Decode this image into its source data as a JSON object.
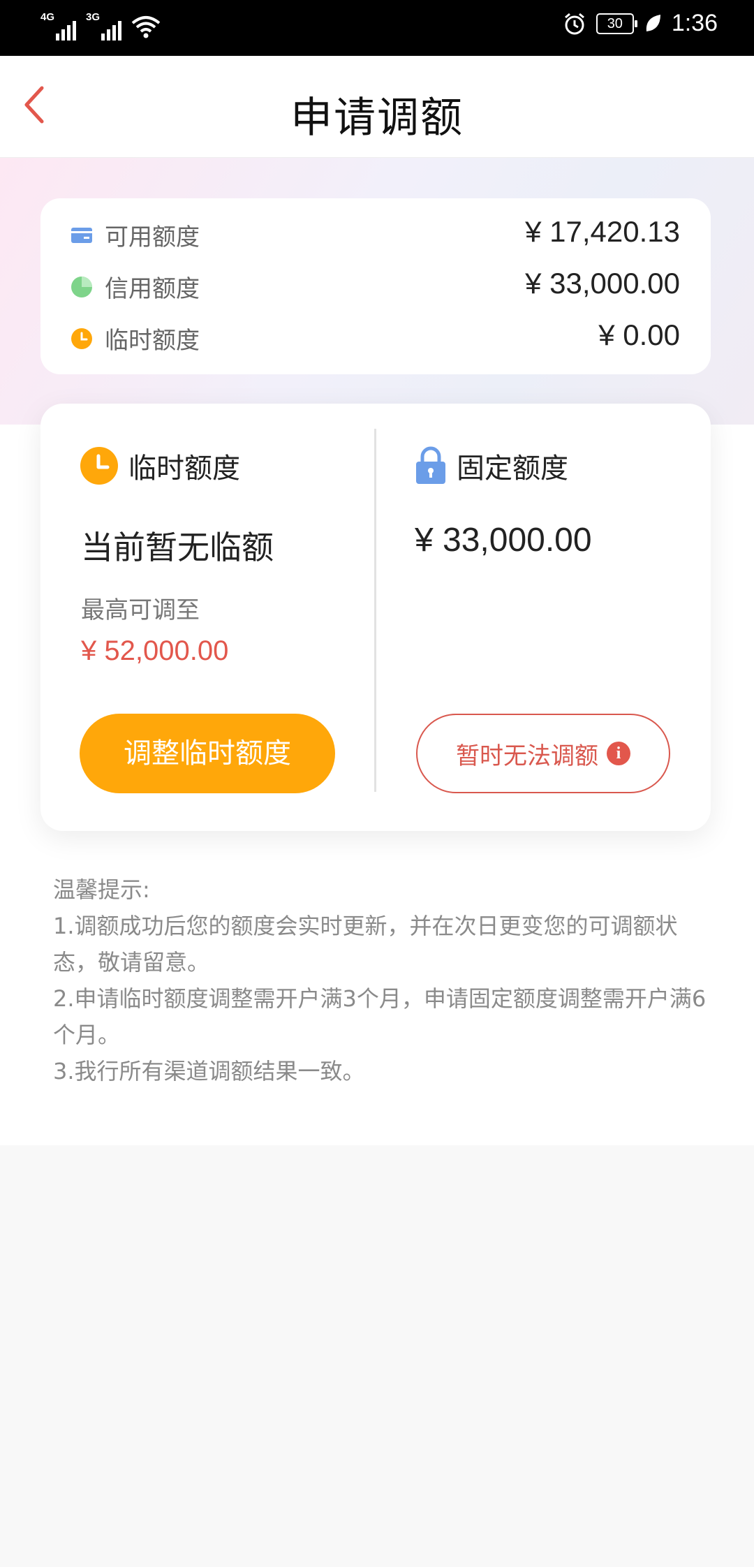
{
  "status_bar": {
    "network_1": "4G",
    "network_2": "3G",
    "battery": "30",
    "time": "1:36"
  },
  "header": {
    "title": "申请调额",
    "back_icon": "chevron-left-icon"
  },
  "summary": {
    "rows": [
      {
        "icon": "card-icon",
        "label": "可用额度",
        "value": "¥ 17,420.13"
      },
      {
        "icon": "pie-chart-icon",
        "label": "信用额度",
        "value": "¥ 33,000.00"
      },
      {
        "icon": "clock-icon",
        "label": "临时额度",
        "value": "¥ 0.00"
      }
    ]
  },
  "temporary": {
    "title": "临时额度",
    "status": "当前暂无临额",
    "max_label": "最高可调至",
    "max_value": "¥ 52,000.00",
    "button_label": "调整临时额度"
  },
  "fixed": {
    "title": "固定额度",
    "amount": "¥ 33,000.00",
    "button_label": "暂时无法调额",
    "info_symbol": "i"
  },
  "tips": {
    "heading": "温馨提示:",
    "items": [
      "1.调额成功后您的额度会实时更新，并在次日更变您的可调额状态，敬请留意。",
      "2.申请临时额度调整需开户满3个月，申请固定额度调整需开户满6个月。",
      "3.我行所有渠道调额结果一致。"
    ]
  },
  "colors": {
    "accent_orange": "#ffa70a",
    "accent_red": "#e2574c",
    "icon_blue": "#6b9de8",
    "icon_green": "#7ed48a"
  }
}
